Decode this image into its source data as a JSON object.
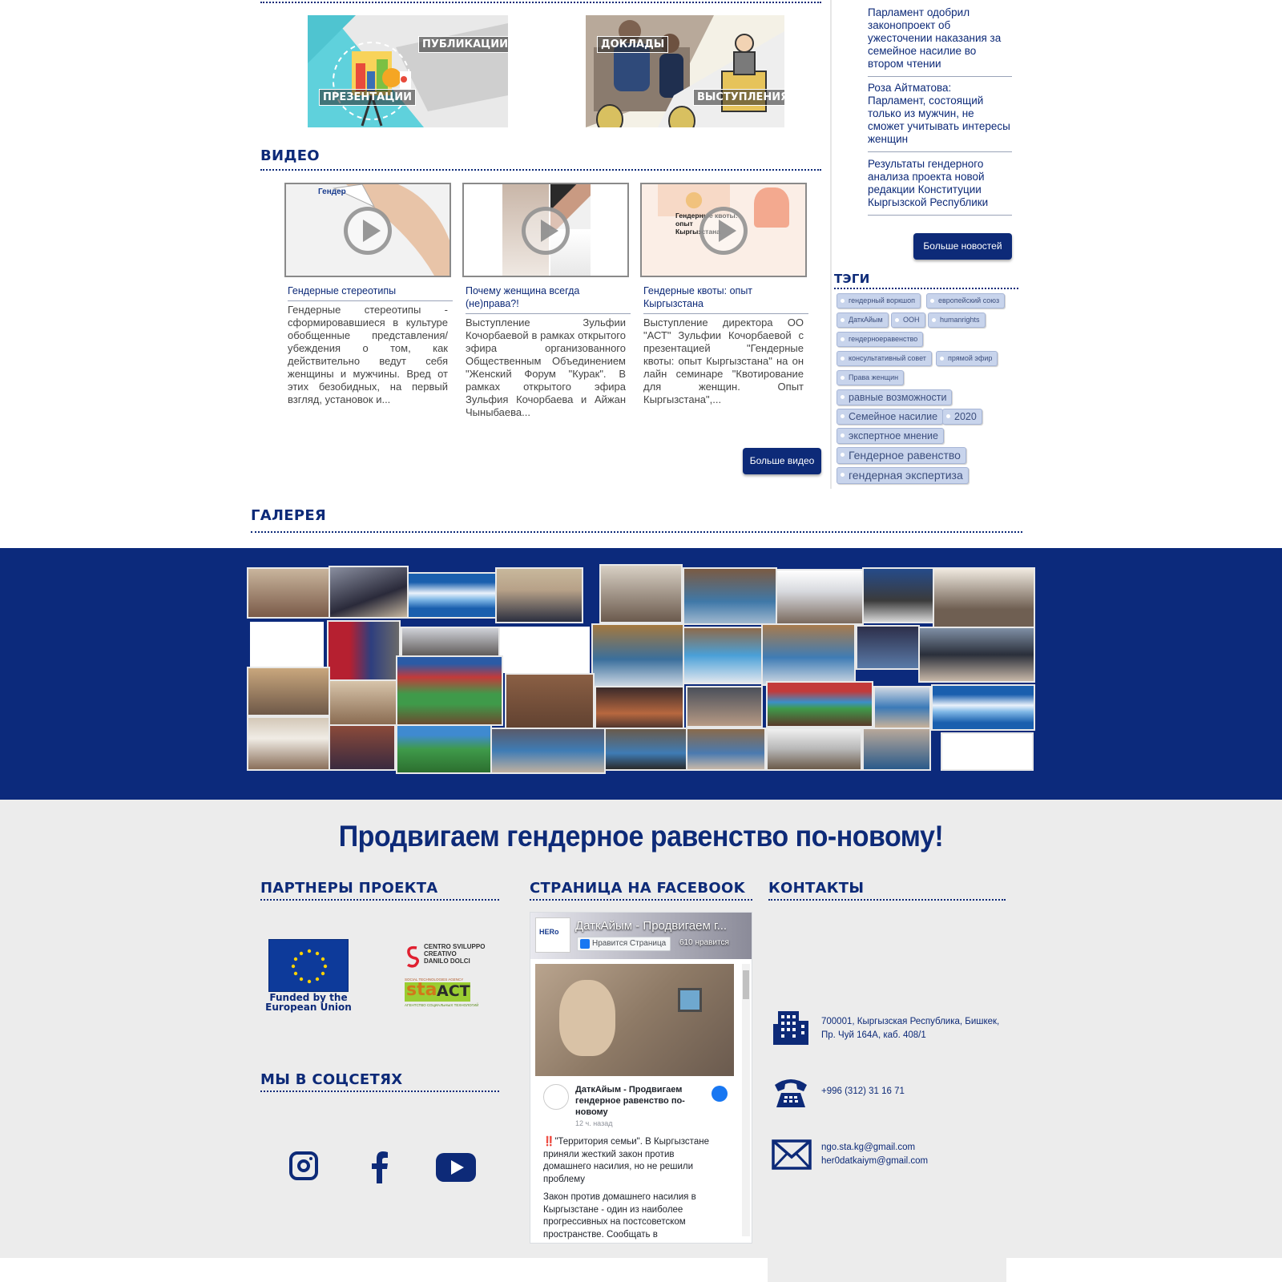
{
  "tiles": {
    "left": {
      "label_top": "ПУБЛИКАЦИИ",
      "label_bottom": "ПРЕЗЕНТАЦИИ"
    },
    "right": {
      "label_top": "ДОКЛАДЫ",
      "label_bottom": "ВЫСТУПЛЕНИЯ"
    }
  },
  "video": {
    "title": "ВИДЕО",
    "items": [
      {
        "thumb_text": "Гендер",
        "title": "Гендерные стереотипы",
        "desc": "Гендерные стереотипы - сформировавшиеся в культуре обобщенные представления/убеждения о том, как действительно ведут себя женщины и мужчины. Вред от этих безобидных, на первый взгляд, установок и..."
      },
      {
        "thumb_text": "",
        "title": "Почему женщина всегда (не)права?!",
        "desc": "Выступление Зульфии Кочорбаевой в рамках открытого эфира организованного Общественным Объединением \"Женский Форум \"Курак\". В рамках открытого эфира Зульфия Кочорбаева и Айжан Чыныбаева..."
      },
      {
        "thumb_text": "Гендерные квоты: опыт Кыргызстана",
        "title": "Гендерные квоты: опыт Кыргызстана",
        "desc": "Выступление директора ОО \"АСТ\" Зульфии Кочорбаевой с презентацией \"Гендерные квоты: опыт Кыргызстана\" на он лайн семинаре \"Квотирование для женщин. Опыт Кыргызстана\",..."
      }
    ],
    "more_button": "Больше видео"
  },
  "news": {
    "items": [
      "Парламент одобрил законопроект об ужесточении наказания за семейное насилие во втором чтении",
      "Роза Айтматова: Парламент, состоящий только из мужчин, не сможет учитывать интересы женщин",
      "Результаты гендерного анализа проекта новой редакции Конституции Кыргызской Республики"
    ],
    "more_button": "Больше новостей"
  },
  "tags": {
    "title": "ТЭГИ",
    "items": [
      "гендерный воркшоп",
      "европейский союз",
      "ДаткАйым",
      "ООН",
      "humanrights",
      "гендерноеравенство",
      "консультативный совет",
      "прямой эфир",
      "Права женщин",
      "равные возможности",
      "Семейное насилие",
      "2020",
      "экспертное мнение",
      "Гендерное равенство",
      "гендерная экспертиза"
    ]
  },
  "gallery": {
    "title": "ГАЛЕРЕЯ"
  },
  "footer": {
    "slogan": "Продвигаем гендерное равенство по-новому!",
    "partners": {
      "title": "ПАРТНЕРЫ ПРОЕКТА",
      "eu_caption_1": "Funded by the",
      "eu_caption_2": "European Union",
      "cesd_1": "CENTRO SVILUPPO",
      "cesd_2": "CREATIVO",
      "cesd_3": "DANILO DOLCI",
      "sta_top": "SOCIAL TECHNOLOGIES AGENCY",
      "sta_main_1": "sta",
      "sta_main_2": "ACT",
      "sta_bottom": "АГЕНТСТВО СОЦИАЛЬНЫХ ТЕХНОЛОГИЙ"
    },
    "social": {
      "title": "МЫ В СОЦСЕТЯХ"
    },
    "facebook": {
      "title": "СТРАНИЦА НА FACEBOOK",
      "page_name": "ДаткАйым - Продвигаем г...",
      "like_button": "Нравится Страница",
      "likes": "610 нравится",
      "logo_text": "HERo",
      "post_author": "ДаткАйым - Продвигаем гендерное равенство по-новому",
      "post_time": "12 ч. назад",
      "post_text_1": "‼️\"Территория семьи\". В Кыргызстане приняли жесткий закон против домашнего насилия, но не решили проблему",
      "post_text_2": "Закон против домашнего насилия в Кыргызстане - один из наиболее прогрессивных на постсоветском пространстве. Сообщать в"
    },
    "contacts": {
      "title": "КОНТАКТЫ",
      "address_1": "700001, Кыргызская Республика, Бишкек,",
      "address_2": "Пр. Чуй 164А, каб. 408/1",
      "phone": "+996 (312) 31 16 71",
      "email_1": "ngo.sta.kg@gmail.com",
      "email_2": "her0datkaiym@gmail.com"
    }
  },
  "colors": {
    "brand": "#0d2a78",
    "gallery_band": "#0c2a7c",
    "footer_bg": "#ececec",
    "tag_bg": "#c8d4ec"
  }
}
